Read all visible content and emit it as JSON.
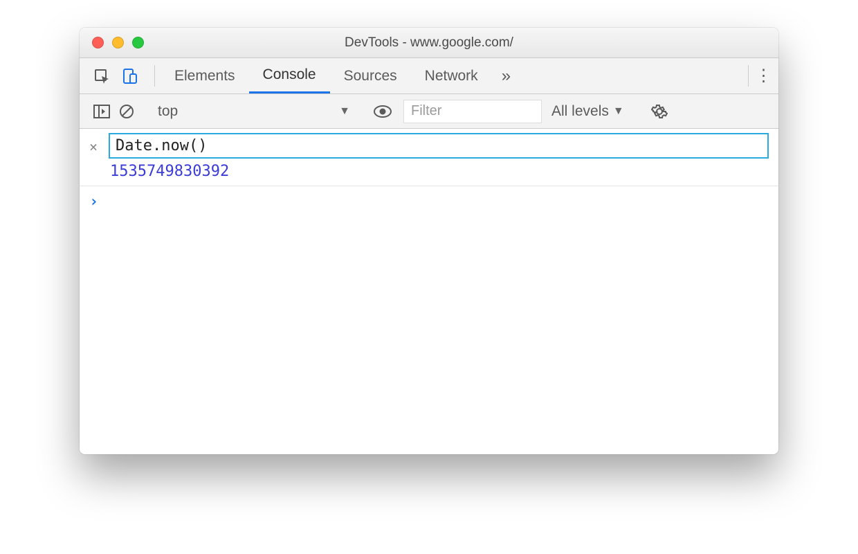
{
  "window": {
    "title": "DevTools - www.google.com/"
  },
  "tabs": {
    "items": [
      "Elements",
      "Console",
      "Sources",
      "Network"
    ],
    "active_index": 1,
    "overflow_glyph": "»",
    "kebab_glyph": "⋮"
  },
  "toolbar": {
    "context": "top",
    "filter_placeholder": "Filter",
    "levels_label": "All levels",
    "dropdown_glyph": "▼"
  },
  "console": {
    "eager_input": "Date.now()",
    "eager_result": "1535749830392",
    "prompt_glyph": "›",
    "close_glyph": "×"
  }
}
